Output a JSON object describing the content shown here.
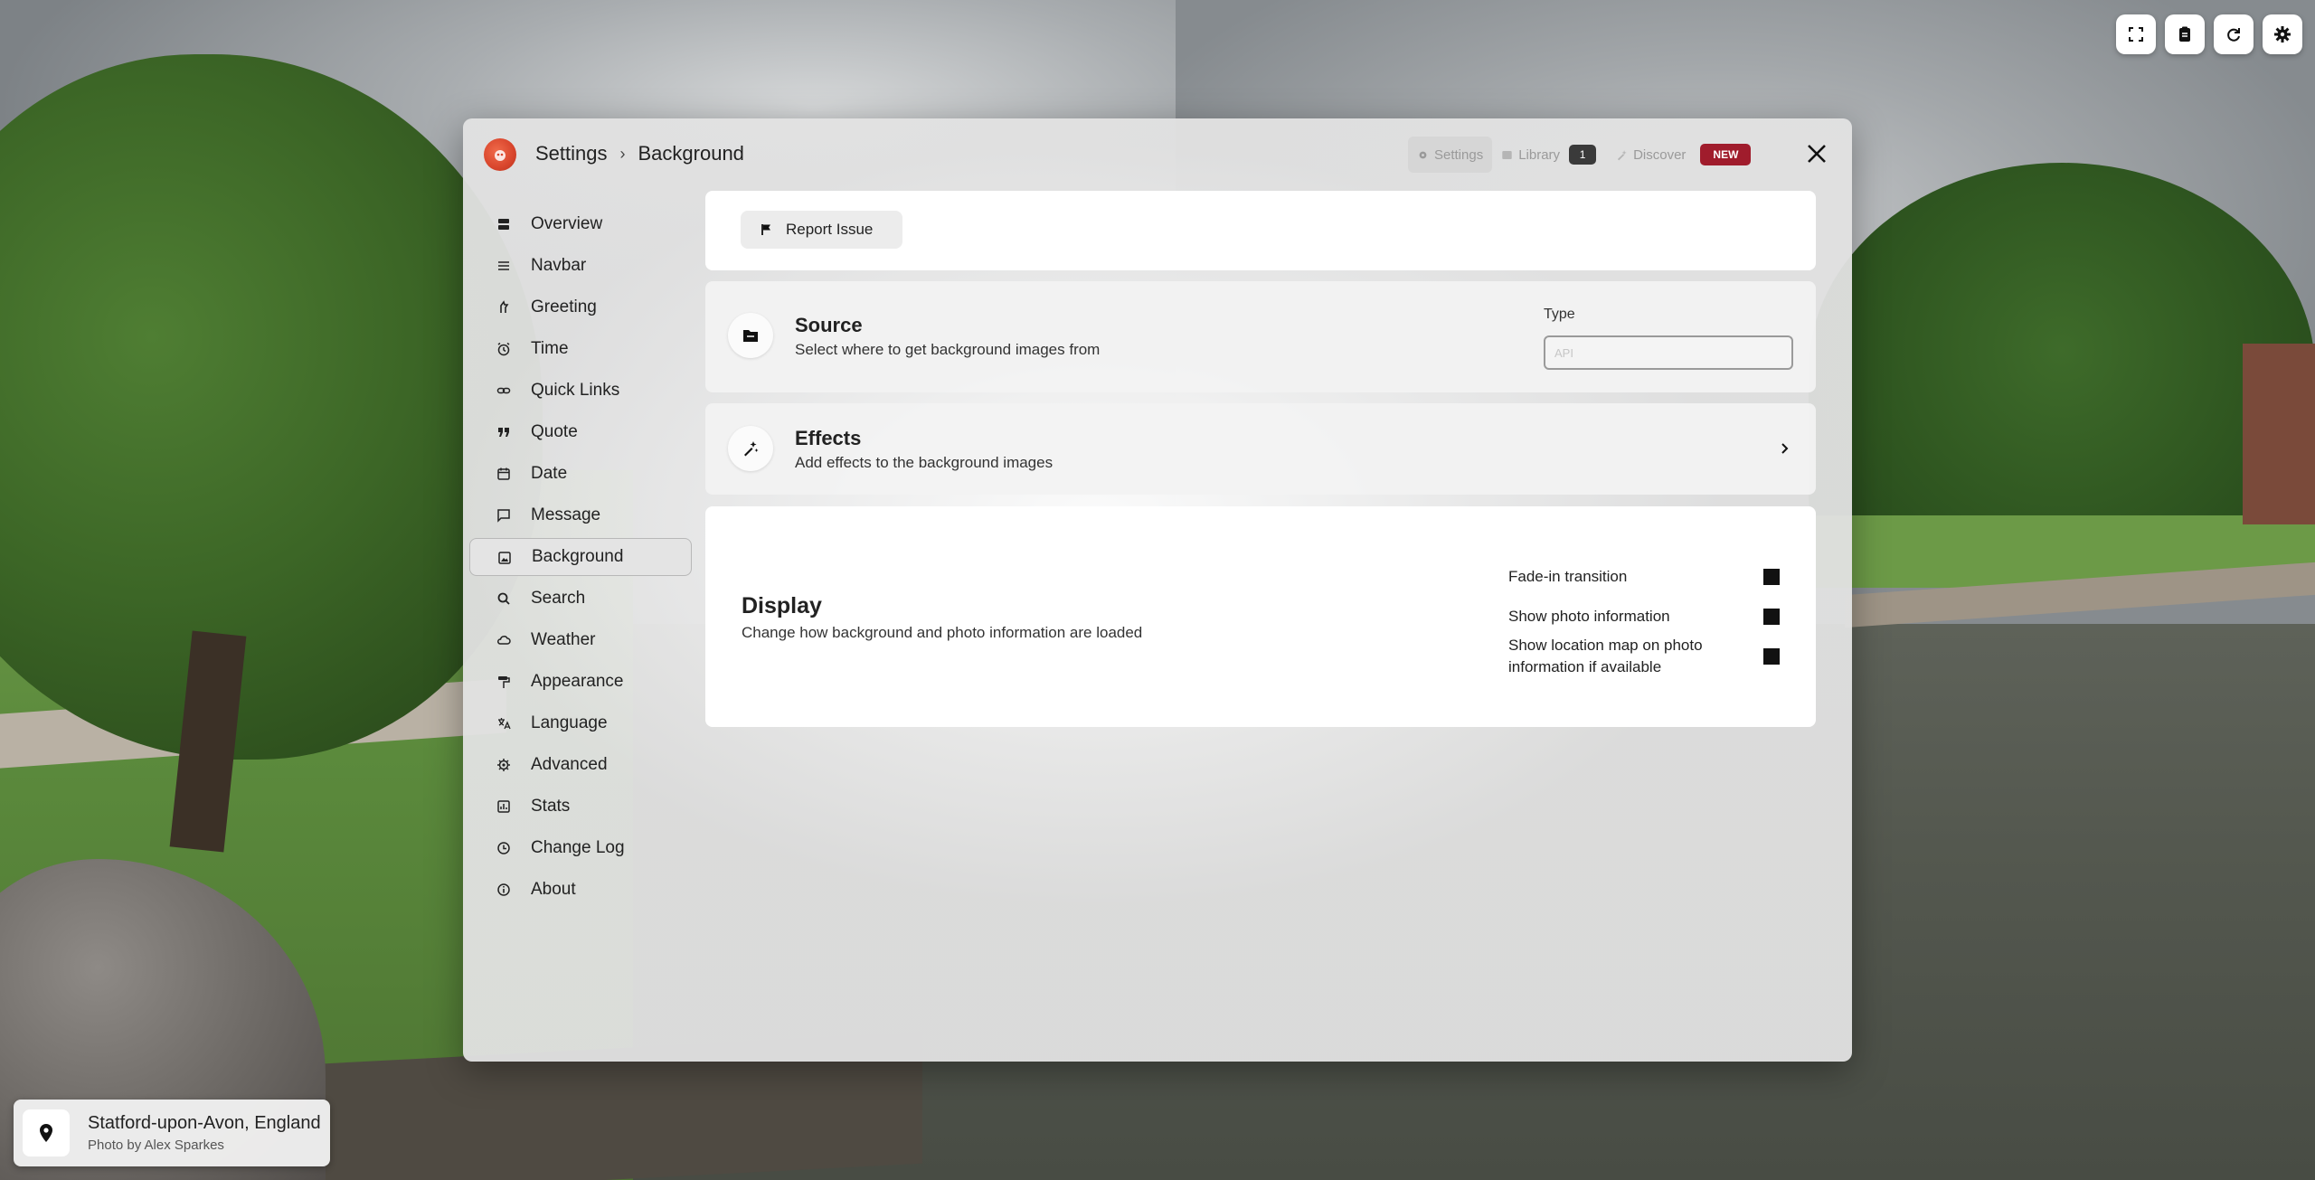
{
  "colors": {
    "accent": "#a01c2c",
    "logo": "#d8452c",
    "text": "#222222",
    "muted": "#9a9a9a"
  },
  "top_buttons": [
    {
      "name": "fullscreen-icon"
    },
    {
      "name": "notes-icon"
    },
    {
      "name": "refresh-icon"
    },
    {
      "name": "settings-gear-icon"
    }
  ],
  "location": {
    "title": "Statford-upon-Avon, England",
    "credit": "Photo by Alex Sparkes",
    "icon": "map-pin-icon"
  },
  "header": {
    "breadcrumb_root": "Settings",
    "breadcrumb_sep": "›",
    "breadcrumb_current": "Background",
    "tabs": {
      "settings": "Settings",
      "library": "Library",
      "library_count": "1",
      "discover": "Discover",
      "discover_badge": "NEW"
    }
  },
  "sidebar": {
    "items": [
      {
        "label": "Overview",
        "icon": "overview-icon"
      },
      {
        "label": "Navbar",
        "icon": "navbar-icon"
      },
      {
        "label": "Greeting",
        "icon": "greeting-icon"
      },
      {
        "label": "Time",
        "icon": "alarm-icon"
      },
      {
        "label": "Quick Links",
        "icon": "link-icon"
      },
      {
        "label": "Quote",
        "icon": "quote-icon"
      },
      {
        "label": "Date",
        "icon": "calendar-icon"
      },
      {
        "label": "Message",
        "icon": "message-icon"
      },
      {
        "label": "Background",
        "icon": "image-icon",
        "active": true
      },
      {
        "label": "Search",
        "icon": "search-icon"
      },
      {
        "label": "Weather",
        "icon": "cloud-icon"
      },
      {
        "label": "Appearance",
        "icon": "paint-roller-icon"
      },
      {
        "label": "Language",
        "icon": "translate-icon"
      },
      {
        "label": "Advanced",
        "icon": "advanced-gear-icon"
      },
      {
        "label": "Stats",
        "icon": "stats-icon"
      },
      {
        "label": "Change Log",
        "icon": "history-icon"
      },
      {
        "label": "About",
        "icon": "info-icon"
      }
    ]
  },
  "report": {
    "label": "Report Issue"
  },
  "source": {
    "title": "Source",
    "description": "Select where to get background images from",
    "type_label": "Type",
    "type_value": "API"
  },
  "effects": {
    "title": "Effects",
    "description": "Add effects to the background images"
  },
  "display": {
    "title": "Display",
    "description": "Change how background and photo information are loaded",
    "options": [
      {
        "label": "Fade-in transition"
      },
      {
        "label": "Show photo information"
      },
      {
        "label": "Show location map on photo information if available"
      }
    ]
  }
}
